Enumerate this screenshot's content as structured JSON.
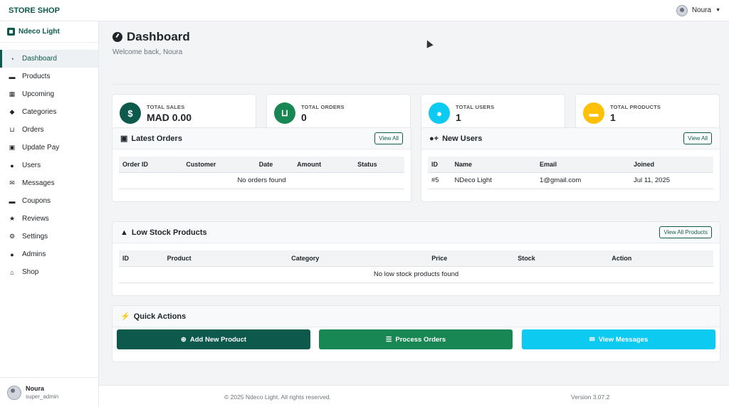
{
  "topbar": {
    "brand": "STORE SHOP",
    "user_name": "Noura"
  },
  "sidebar": {
    "brand": "Ndeco Light",
    "items": [
      {
        "label": "Dashboard",
        "icon": "gauge-icon",
        "active": true
      },
      {
        "label": "Products",
        "icon": "box-icon"
      },
      {
        "label": "Upcoming",
        "icon": "calendar-icon"
      },
      {
        "label": "Categories",
        "icon": "tags-icon"
      },
      {
        "label": "Orders",
        "icon": "cart-icon"
      },
      {
        "label": "Update Pay",
        "icon": "money-icon"
      },
      {
        "label": "Users",
        "icon": "users-icon"
      },
      {
        "label": "Messages",
        "icon": "envelope-icon"
      },
      {
        "label": "Coupons",
        "icon": "ticket-icon"
      },
      {
        "label": "Reviews",
        "icon": "star-icon"
      },
      {
        "label": "Settings",
        "icon": "gear-icon"
      },
      {
        "label": "Admins",
        "icon": "admins-icon"
      },
      {
        "label": "Shop",
        "icon": "store-icon"
      }
    ],
    "user": {
      "name": "Noura",
      "role": "super_admin"
    }
  },
  "page": {
    "title": "Dashboard",
    "subtitle": "Welcome back, Noura"
  },
  "stats": [
    {
      "label": "TOTAL SALES",
      "value": "MAD 0.00",
      "color": "#0d5a4d",
      "icon": "dollar-icon"
    },
    {
      "label": "TOTAL ORDERS",
      "value": "0",
      "color": "#198754",
      "icon": "cart-icon"
    },
    {
      "label": "TOTAL USERS",
      "value": "1",
      "color": "#0dcaf0",
      "icon": "users-icon"
    },
    {
      "label": "TOTAL PRODUCTS",
      "value": "1",
      "color": "#ffc107",
      "icon": "box-icon"
    }
  ],
  "latest_orders": {
    "title": "Latest Orders",
    "button": "View All",
    "columns": [
      "Order ID",
      "Customer",
      "Date",
      "Amount",
      "Status"
    ],
    "empty": "No orders found"
  },
  "new_users": {
    "title": "New Users",
    "button": "View All",
    "columns": [
      "ID",
      "Name",
      "Email",
      "Joined"
    ],
    "rows": [
      [
        "#5",
        "NDeco Light",
        "1@gmail.com",
        "Jul 11, 2025"
      ]
    ]
  },
  "low_stock": {
    "title": "Low Stock Products",
    "button": "View All Products",
    "columns": [
      "ID",
      "Product",
      "Category",
      "Price",
      "Stock",
      "Action"
    ],
    "empty": "No low stock products found"
  },
  "quick_actions": {
    "title": "Quick Actions",
    "buttons": [
      {
        "label": "Add New Product",
        "color": "#0d5a4d",
        "icon": "plus-circle-icon"
      },
      {
        "label": "Process Orders",
        "color": "#198754",
        "icon": "list-check-icon"
      },
      {
        "label": "View Messages",
        "color": "#0dcaf0",
        "icon": "envelope-icon"
      }
    ]
  },
  "footer": {
    "copyright": "© 2025 Ndeco Light. All rights reserved.",
    "version": "Version 3.07.2"
  }
}
